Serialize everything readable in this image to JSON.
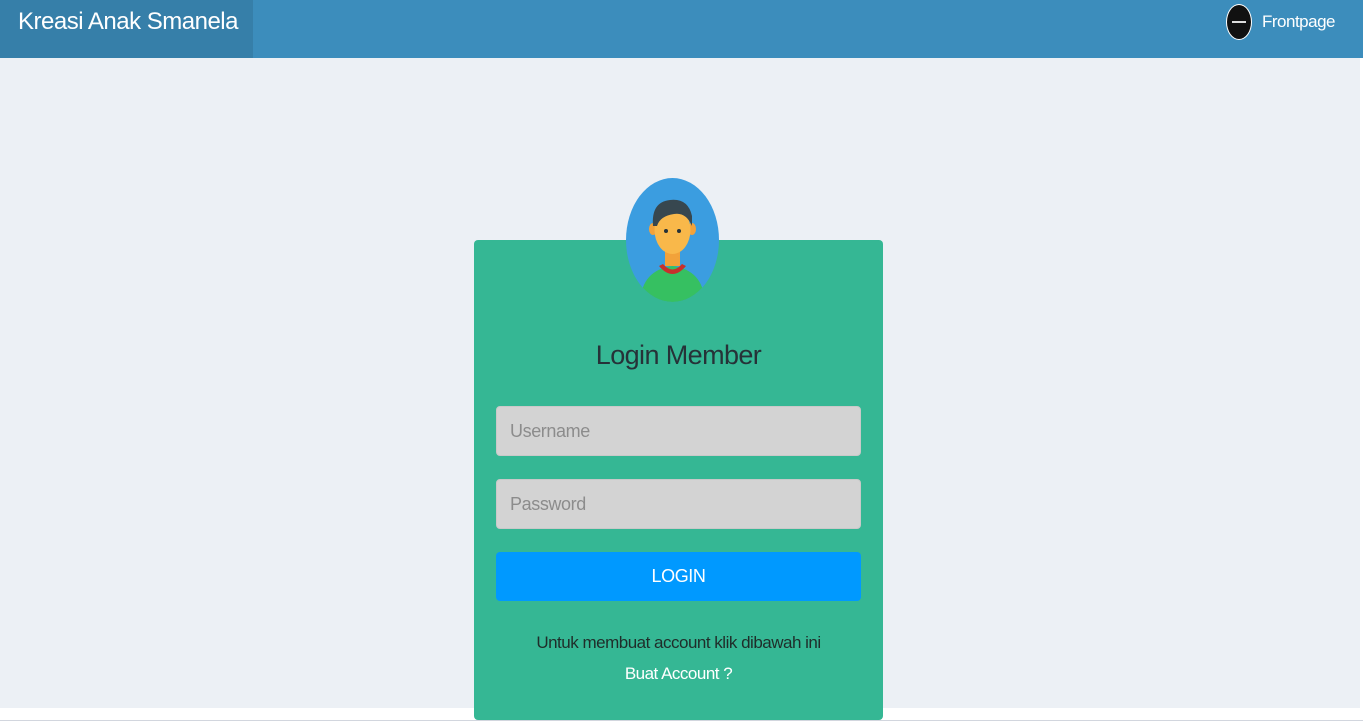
{
  "header": {
    "brand": "Kreasi Anak Smanela",
    "nav_link_label": "Frontpage",
    "nav_avatar_icon": "user-avatar-icon",
    "colors": {
      "bar": "#3c8dbc",
      "brand_bg": "#367fa9"
    }
  },
  "login": {
    "avatar_icon": "user-avatar-icon",
    "title": "Login Member",
    "username_placeholder": "Username",
    "username_value": "",
    "password_placeholder": "Password",
    "password_value": "",
    "button_label": "LOGIN",
    "hint_text": "Untuk membuat account klik dibawah ini",
    "create_account_label": "Buat Account ?",
    "colors": {
      "card": "#35b794",
      "button": "#0099ff",
      "field": "#d3d3d3"
    }
  },
  "page": {
    "background": "#ecf0f5"
  }
}
